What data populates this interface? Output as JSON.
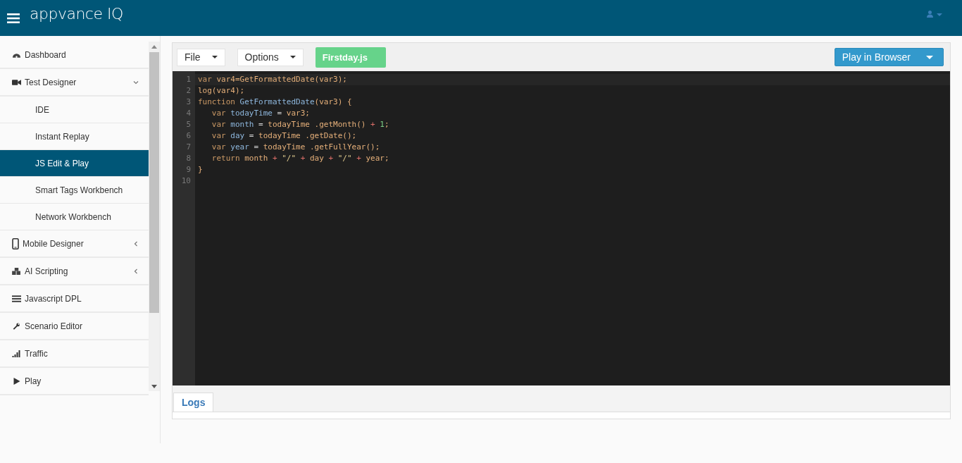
{
  "header": {
    "logo": "appvance IQ"
  },
  "sidebar": {
    "items": [
      {
        "label": "Dashboard"
      },
      {
        "label": "Test Designer",
        "expanded": true,
        "children": [
          {
            "label": "IDE",
            "selected": false
          },
          {
            "label": "Instant Replay",
            "selected": false
          },
          {
            "label": "JS Edit & Play",
            "selected": true
          },
          {
            "label": "Smart Tags Workbench",
            "selected": false
          },
          {
            "label": "Network Workbench",
            "selected": false
          }
        ]
      },
      {
        "label": "Mobile Designer",
        "expanded": false
      },
      {
        "label": "AI Scripting",
        "expanded": false
      },
      {
        "label": "Javascript DPL"
      },
      {
        "label": "Scenario Editor"
      },
      {
        "label": "Traffic"
      },
      {
        "label": "Play"
      }
    ]
  },
  "toolbar": {
    "menus": [
      "File",
      "Options"
    ],
    "file_tab": "Firstday.js",
    "play_button": "Play in Browser"
  },
  "editor": {
    "lines": [
      {
        "number": "1",
        "tokens": [
          {
            "kind": "keyword",
            "text": "var "
          },
          {
            "kind": "call",
            "text": "var4=GetFormattedDate(var3);"
          }
        ]
      },
      {
        "number": "2",
        "tokens": [
          {
            "kind": "call",
            "text": "log(var4);"
          }
        ]
      },
      {
        "number": "3",
        "tokens": [
          {
            "kind": "keyword",
            "text": "function "
          },
          {
            "kind": "ident",
            "text": "GetFormattedDate"
          },
          {
            "kind": "call",
            "text": "(var3) {"
          }
        ]
      },
      {
        "number": "4",
        "tokens": [
          {
            "kind": "keyword",
            "text": "   var "
          },
          {
            "kind": "ident",
            "text": "todayTime"
          },
          {
            "kind": "punct",
            "text": " = "
          },
          {
            "kind": "call",
            "text": "var3;"
          }
        ]
      },
      {
        "number": "5",
        "tokens": [
          {
            "kind": "keyword",
            "text": "   var "
          },
          {
            "kind": "ident",
            "text": "month"
          },
          {
            "kind": "punct",
            "text": " = "
          },
          {
            "kind": "call",
            "text": "todayTime .getMonth() "
          },
          {
            "kind": "op",
            "text": "+ "
          },
          {
            "kind": "number",
            "text": "1"
          },
          {
            "kind": "call",
            "text": ";"
          }
        ]
      },
      {
        "number": "6",
        "tokens": [
          {
            "kind": "keyword",
            "text": "   var "
          },
          {
            "kind": "ident",
            "text": "day"
          },
          {
            "kind": "punct",
            "text": " = "
          },
          {
            "kind": "call",
            "text": "todayTime .getDate();"
          }
        ]
      },
      {
        "number": "7",
        "tokens": [
          {
            "kind": "keyword",
            "text": "   var "
          },
          {
            "kind": "ident",
            "text": "year"
          },
          {
            "kind": "punct",
            "text": " = "
          },
          {
            "kind": "call",
            "text": "todayTime .getFullYear();"
          }
        ]
      },
      {
        "number": "8",
        "tokens": [
          {
            "kind": "keyword",
            "text": "   return "
          },
          {
            "kind": "call",
            "text": "month "
          },
          {
            "kind": "op",
            "text": "+ "
          },
          {
            "kind": "string",
            "text": "\"/\" "
          },
          {
            "kind": "op",
            "text": "+ "
          },
          {
            "kind": "call",
            "text": "day "
          },
          {
            "kind": "op",
            "text": "+ "
          },
          {
            "kind": "string",
            "text": "\"/\" "
          },
          {
            "kind": "op",
            "text": "+ "
          },
          {
            "kind": "call",
            "text": "year;"
          }
        ]
      },
      {
        "number": "9",
        "tokens": [
          {
            "kind": "call",
            "text": "}"
          }
        ]
      },
      {
        "number": "10"
      }
    ]
  },
  "logs": {
    "tabs": [
      {
        "label": "Logs",
        "selected": true
      }
    ]
  }
}
